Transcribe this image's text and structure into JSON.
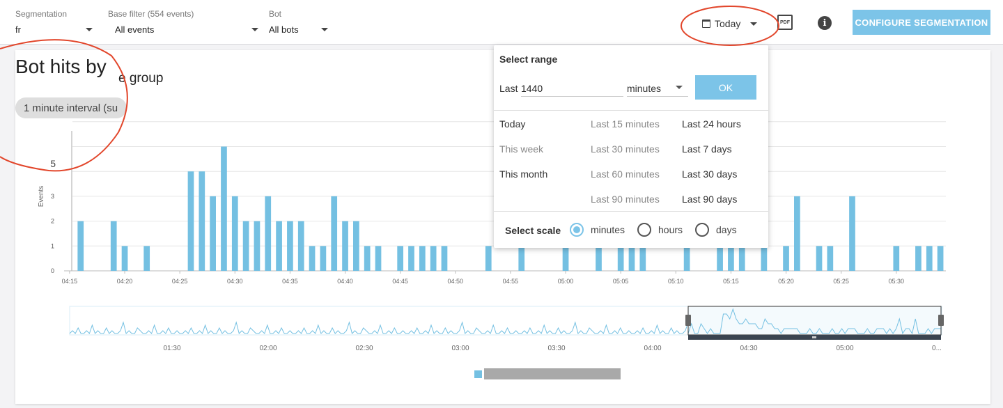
{
  "filters": {
    "segmentation": {
      "label": "Segmentation",
      "value": "fr"
    },
    "base_filter": {
      "label": "Base filter (554 events)",
      "value": "All events"
    },
    "bot": {
      "label": "Bot",
      "value": "All bots"
    }
  },
  "toolbar": {
    "date_label": "Today",
    "pdf_label": "PDF",
    "info_label": "i",
    "configure_label": "CONFIGURE SEGMENTATION"
  },
  "chart": {
    "title_left": "Bot hits by",
    "title_right": "e group",
    "interval_chip": "1 minute interval (su"
  },
  "range_popup": {
    "header": "Select range",
    "last_label": "Last",
    "last_value": "1440",
    "unit": "minutes",
    "ok_label": "OK",
    "col1": [
      "Today",
      "This week",
      "This month"
    ],
    "col2": [
      "Last 15 minutes",
      "Last 30 minutes",
      "Last 60 minutes",
      "Last 90 minutes"
    ],
    "col3": [
      "Last 24 hours",
      "Last 7 days",
      "Last 30 days",
      "Last 90 days"
    ],
    "scale_label": "Select scale",
    "scales": [
      "minutes",
      "hours",
      "days"
    ],
    "selected_scale": "minutes"
  },
  "colors": {
    "bar": "#74c0e2",
    "accent": "#7cc4e8",
    "annotation": "#e2462b"
  },
  "chart_data": {
    "type": "bar",
    "ylabel": "Events",
    "y_ticks": [
      0,
      1,
      2,
      3
    ],
    "y_top_label": "5",
    "x_ticks": [
      "04:15",
      "04:20",
      "04:25",
      "04:30",
      "04:35",
      "04:40",
      "04:45",
      "04:50",
      "04:55",
      "05:00",
      "05:05",
      "05:10",
      "05:15",
      "05:20",
      "05:25",
      "05:30"
    ],
    "x_start_minute": 255,
    "values": [
      0,
      2,
      0,
      0,
      2,
      1,
      0,
      1,
      0,
      0,
      0,
      4,
      4,
      3,
      5,
      3,
      2,
      2,
      3,
      2,
      2,
      2,
      1,
      1,
      3,
      2,
      2,
      1,
      1,
      0,
      1,
      1,
      1,
      1,
      1,
      0,
      0,
      0,
      1,
      0,
      0,
      1,
      0,
      0,
      0,
      1,
      0,
      0,
      1,
      0,
      1,
      1,
      1,
      0,
      0,
      0,
      1,
      0,
      0,
      1,
      1,
      1,
      0,
      1,
      0,
      1,
      3,
      0,
      1,
      1,
      0,
      3,
      0,
      0,
      0,
      1,
      0,
      1,
      1,
      1
    ],
    "values_hidden_note_range": [
      38,
      62
    ],
    "overview_x_ticks": [
      "01:30",
      "02:00",
      "02:30",
      "03:00",
      "03:30",
      "04:00",
      "04:30",
      "05:00",
      "0..."
    ]
  }
}
